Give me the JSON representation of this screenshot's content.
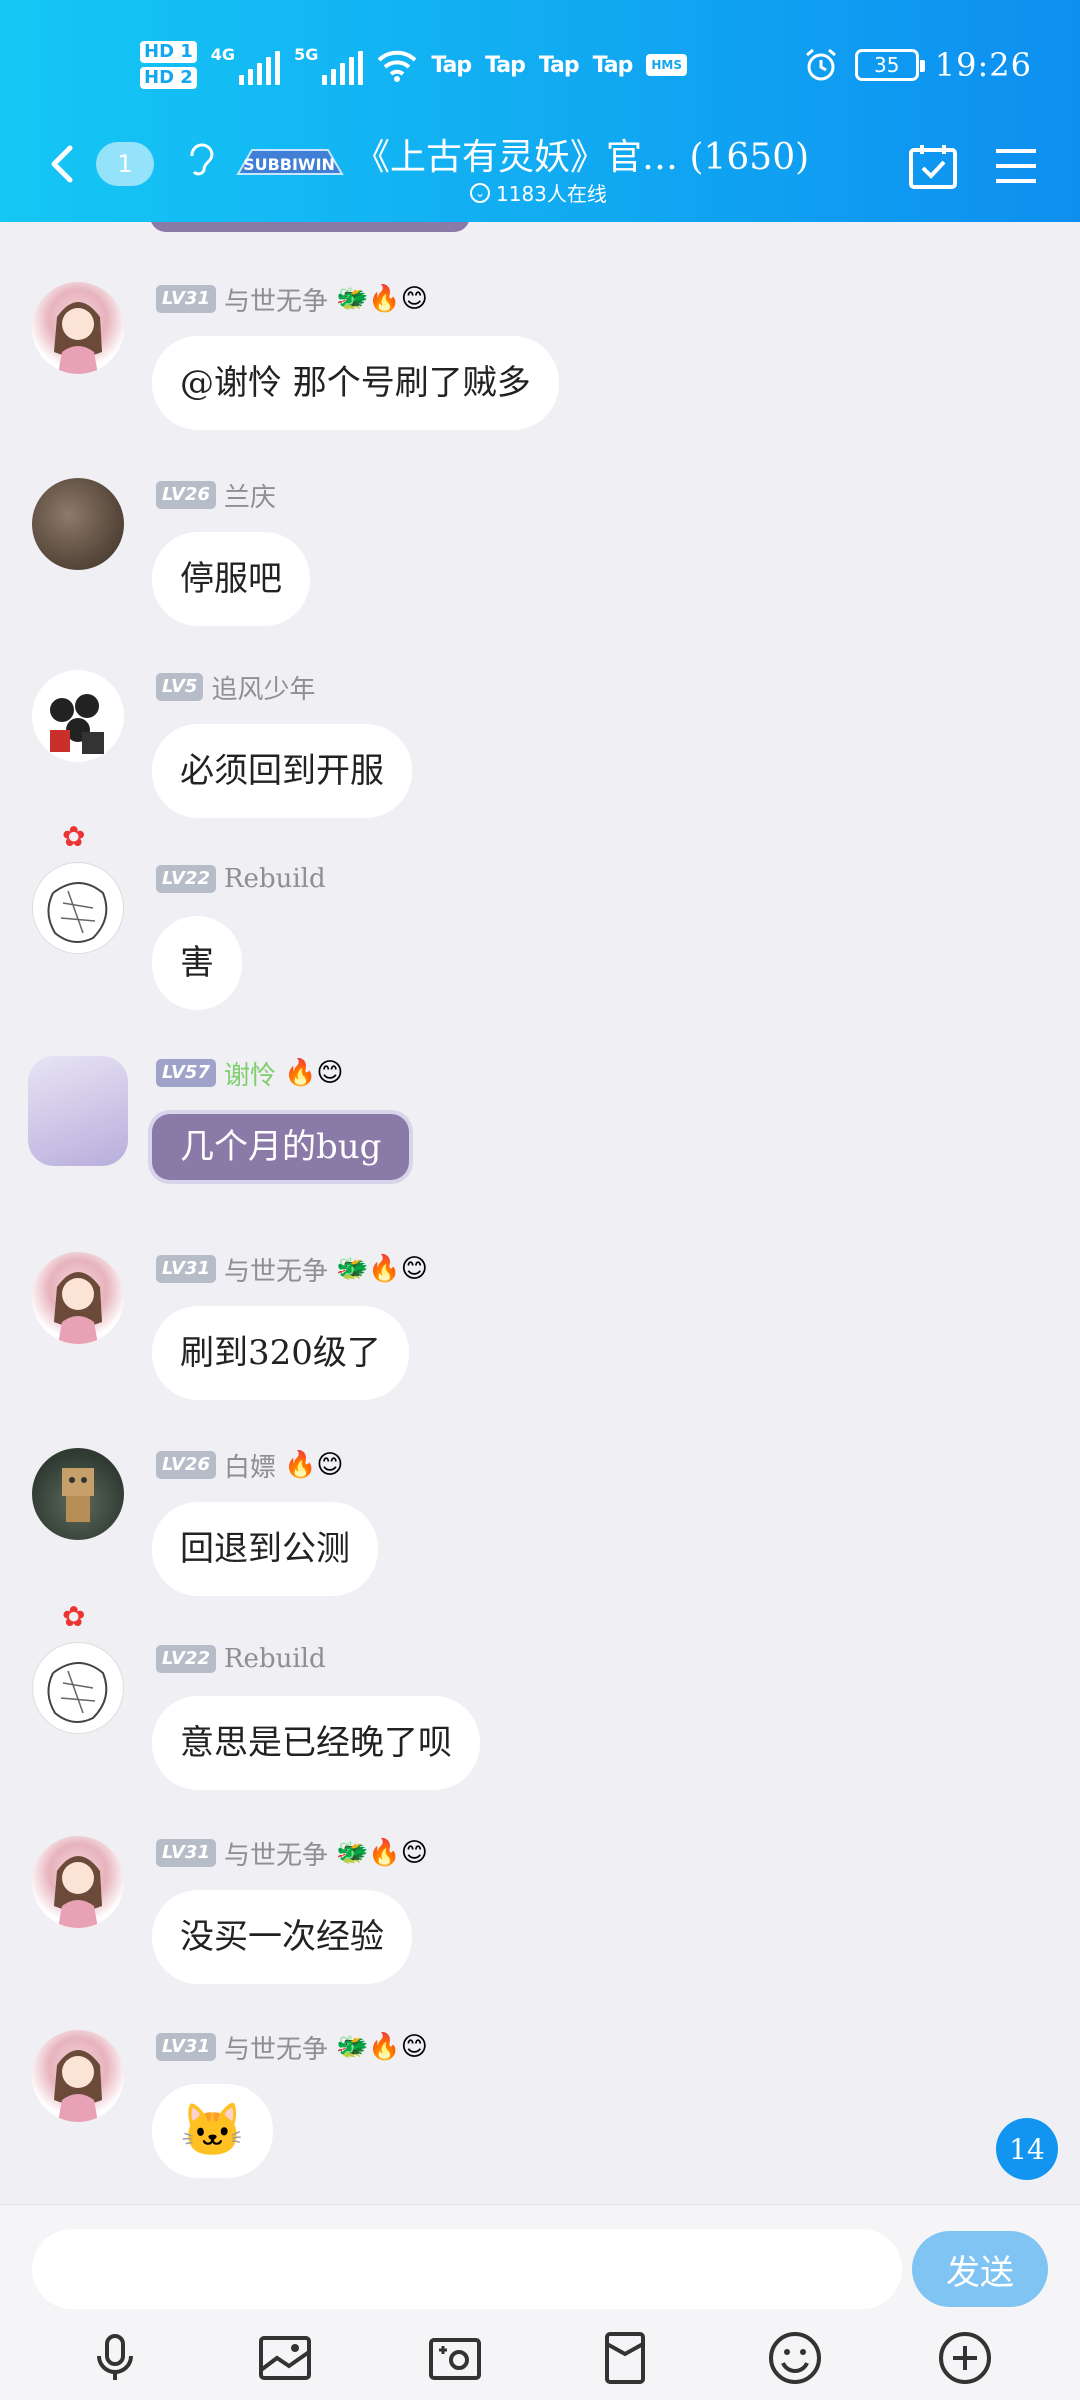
{
  "status_bar": {
    "hd_top": "HD 1",
    "hd_bottom": "HD 2",
    "net1": "4G",
    "net2": "5G",
    "taps": [
      "Tap",
      "Tap",
      "Tap",
      "Tap"
    ],
    "hms": "HMS",
    "battery": "35",
    "time": "19:26"
  },
  "header": {
    "unread": "1",
    "title": "《上古有灵妖》官… (1650)",
    "online": "1183人在线",
    "logo_text": "SUBBIWIN"
  },
  "messages": [
    {
      "level": "LV31",
      "name": "与世无争",
      "badges": "🐲🔥😊",
      "text": "@谢怜 那个号刷了贼多",
      "avatar": "anime-girl"
    },
    {
      "level": "LV26",
      "name": "兰庆",
      "badges": "",
      "text": "停服吧",
      "avatar": "brown-photo"
    },
    {
      "level": "LV5",
      "name": "追风少年",
      "badges": "",
      "text": "必须回到开服",
      "avatar": "group-photo"
    },
    {
      "level": "LV22",
      "name": "Rebuild",
      "badges": "",
      "text": "害",
      "avatar": "sketch"
    },
    {
      "level": "LV57",
      "name": "谢怜",
      "badges": "🔥😊",
      "text": "几个月的bug",
      "avatar": "perfume-bottle"
    },
    {
      "level": "LV31",
      "name": "与世无争",
      "badges": "🐲🔥😊",
      "text": "刷到320级了",
      "avatar": "anime-girl"
    },
    {
      "level": "LV26",
      "name": "白嫖",
      "badges": "🔥😊",
      "text": "回退到公测",
      "avatar": "box-robot"
    },
    {
      "level": "LV22",
      "name": "Rebuild",
      "badges": "",
      "text": "意思是已经晚了呗",
      "avatar": "sketch"
    },
    {
      "level": "LV31",
      "name": "与世无争",
      "badges": "🐲🔥😊",
      "text": "没买一次经验",
      "avatar": "anime-girl"
    },
    {
      "level": "LV31",
      "name": "与世无争",
      "badges": "🐲🔥😊",
      "text": "🐱",
      "avatar": "anime-girl"
    }
  ],
  "new_message_count": "14",
  "input": {
    "placeholder": "",
    "send_label": "发送"
  },
  "colors": {
    "header_start": "#15c7f5",
    "header_end": "#0d8ff0",
    "send_button": "#7fc4f2",
    "background": "#efeff4"
  }
}
